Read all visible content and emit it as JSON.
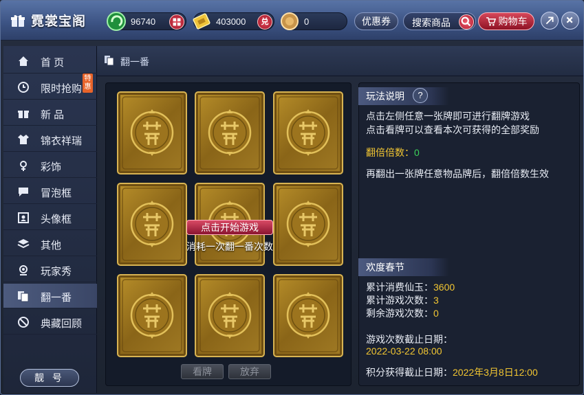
{
  "app": {
    "title": "霓裳宝阁"
  },
  "currencies": [
    {
      "icon": "jade-swirl-icon",
      "value": "96740",
      "button": ""
    },
    {
      "icon": "gold-ticket-icon",
      "value": "403000",
      "button": "兑"
    },
    {
      "icon": "coin-icon",
      "value": "0",
      "button": ""
    }
  ],
  "toolbar": {
    "coupon_label": "优惠券",
    "search_placeholder": "搜索商品",
    "cart_label": "购物车"
  },
  "sidebar": {
    "items": [
      {
        "label": "首 页",
        "icon": "home-icon"
      },
      {
        "label": "限时抢购",
        "icon": "clock-icon",
        "tag": "特惠"
      },
      {
        "label": "新 品",
        "icon": "gift-icon"
      },
      {
        "label": "锦衣祥瑞",
        "icon": "shirt-icon"
      },
      {
        "label": "彩饰",
        "icon": "ornament-icon"
      },
      {
        "label": "冒泡框",
        "icon": "chat-bubble-icon"
      },
      {
        "label": "头像框",
        "icon": "portrait-frame-icon"
      },
      {
        "label": "其他",
        "icon": "layers-icon"
      },
      {
        "label": "玩家秀",
        "icon": "player-show-icon"
      },
      {
        "label": "翻一番",
        "icon": "cards-icon",
        "active": true
      },
      {
        "label": "典藏回顾",
        "icon": "ban-icon"
      }
    ],
    "account_label": "靓 号"
  },
  "content": {
    "header_title": "翻一番",
    "start_button": "点击开始游戏",
    "start_hint": "消耗一次翻一番次数",
    "view_button": "看牌",
    "give_up_button": "放弃"
  },
  "rules": {
    "title": "玩法说明",
    "help": "?",
    "line1": "点击左侧任意一张牌即可进行翻牌游戏",
    "line2": "点击看牌可以查看本次可获得的全部奖励",
    "multiplier_label": "翻倍倍数：",
    "multiplier_value": "0",
    "note": "再翻出一张牌任意物品牌后，翻倍倍数生效"
  },
  "event": {
    "title": "欢度春节",
    "spent_label": "累计消费仙玉：",
    "spent_value": "3600",
    "played_label": "累计游戏次数：",
    "played_value": "3",
    "remaining_label": "剩余游戏次数：",
    "remaining_value": "0",
    "deadline_label": "游戏次数截止日期：",
    "deadline_value": "2022-03-22 08:00",
    "points_label": "积分获得截止日期：",
    "points_value": "2022年3月8日12:00"
  },
  "colors": {
    "accent_red": "#c2203a",
    "highlight_yellow": "#f2c632",
    "highlight_green": "#3cd35a"
  }
}
